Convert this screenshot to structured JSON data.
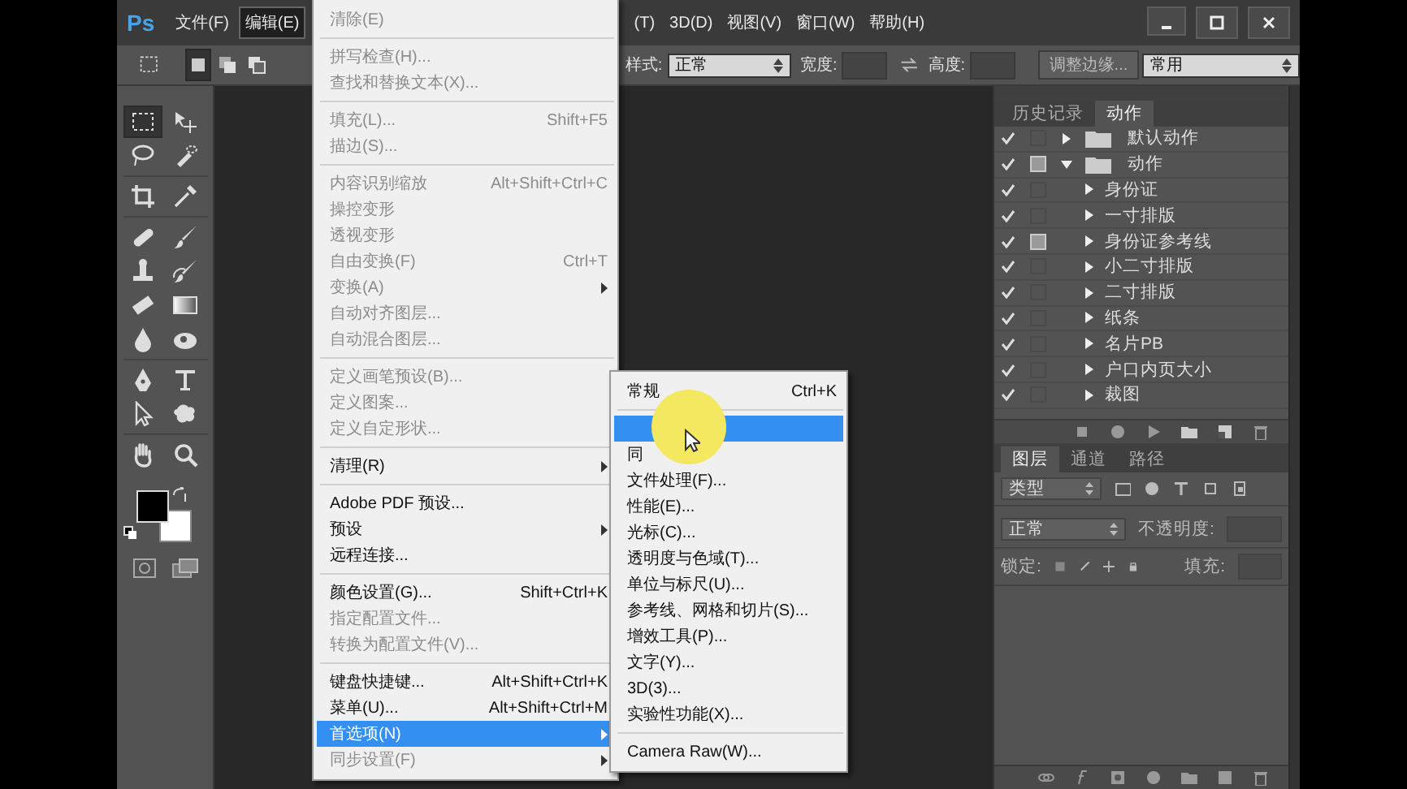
{
  "menu_bar": {
    "logo": "Ps",
    "items": [
      {
        "label": "文件(F)",
        "selected": false
      },
      {
        "label": "编辑(E)",
        "selected": true
      },
      {
        "label": "(T)",
        "selected": false
      },
      {
        "label": "3D(D)",
        "selected": false
      },
      {
        "label": "视图(V)",
        "selected": false
      },
      {
        "label": "窗口(W)",
        "selected": false
      },
      {
        "label": "帮助(H)",
        "selected": false
      }
    ]
  },
  "options_bar": {
    "style_label": "样式:",
    "style_value": "正常",
    "width_label": "宽度:",
    "height_label": "高度:",
    "refine_button": "调整边缘...",
    "workspace": "常用"
  },
  "tools": [
    {
      "kind": "marquee",
      "selected": true
    },
    {
      "kind": "move",
      "selected": false
    },
    {
      "kind": "lasso",
      "selected": false
    },
    {
      "kind": "quick-select",
      "selected": false
    },
    {
      "kind": "crop",
      "selected": false
    },
    {
      "kind": "eyedropper",
      "selected": false
    },
    {
      "kind": "healing",
      "selected": false
    },
    {
      "kind": "brush",
      "selected": false
    },
    {
      "kind": "stamp",
      "selected": false
    },
    {
      "kind": "history-brush",
      "selected": false
    },
    {
      "kind": "eraser",
      "selected": false
    },
    {
      "kind": "gradient",
      "selected": false
    },
    {
      "kind": "blur",
      "selected": false
    },
    {
      "kind": "dodge",
      "selected": false
    },
    {
      "kind": "pen",
      "selected": false
    },
    {
      "kind": "type",
      "selected": false
    },
    {
      "kind": "path-select",
      "selected": false
    },
    {
      "kind": "shape",
      "selected": false
    },
    {
      "kind": "hand",
      "selected": false
    },
    {
      "kind": "zoom",
      "selected": false
    }
  ],
  "edit_menu": {
    "groups": [
      [
        {
          "label": "清除(E)",
          "disabled": true,
          "submenu": false,
          "selected": false
        }
      ],
      [
        {
          "label": "拼写检查(H)...",
          "disabled": true,
          "submenu": false,
          "selected": false
        },
        {
          "label": "查找和替换文本(X)...",
          "disabled": true,
          "submenu": false,
          "selected": false
        }
      ],
      [
        {
          "label": "填充(L)...",
          "shortcut": "Shift+F5",
          "disabled": true,
          "submenu": false,
          "selected": false
        },
        {
          "label": "描边(S)...",
          "disabled": true,
          "submenu": false,
          "selected": false
        }
      ],
      [
        {
          "label": "内容识别缩放",
          "shortcut": "Alt+Shift+Ctrl+C",
          "disabled": true,
          "submenu": false,
          "selected": false
        },
        {
          "label": "操控变形",
          "disabled": true,
          "submenu": false,
          "selected": false
        },
        {
          "label": "透视变形",
          "disabled": true,
          "submenu": false,
          "selected": false
        },
        {
          "label": "自由变换(F)",
          "shortcut": "Ctrl+T",
          "disabled": true,
          "submenu": false,
          "selected": false
        },
        {
          "label": "变换(A)",
          "disabled": true,
          "submenu": true,
          "selected": false
        },
        {
          "label": "自动对齐图层...",
          "disabled": true,
          "submenu": false,
          "selected": false
        },
        {
          "label": "自动混合图层...",
          "disabled": true,
          "submenu": false,
          "selected": false
        }
      ],
      [
        {
          "label": "定义画笔预设(B)...",
          "disabled": true,
          "submenu": false,
          "selected": false
        },
        {
          "label": "定义图案...",
          "disabled": true,
          "submenu": false,
          "selected": false
        },
        {
          "label": "定义自定形状...",
          "disabled": true,
          "submenu": false,
          "selected": false
        }
      ],
      [
        {
          "label": "清理(R)",
          "disabled": false,
          "submenu": true,
          "selected": false
        }
      ],
      [
        {
          "label": "Adobe PDF 预设...",
          "disabled": false,
          "submenu": false,
          "selected": false
        },
        {
          "label": "预设",
          "disabled": false,
          "submenu": true,
          "selected": false
        },
        {
          "label": "远程连接...",
          "disabled": false,
          "submenu": false,
          "selected": false
        }
      ],
      [
        {
          "label": "颜色设置(G)...",
          "shortcut": "Shift+Ctrl+K",
          "disabled": false,
          "submenu": false,
          "selected": false
        },
        {
          "label": "指定配置文件...",
          "disabled": true,
          "submenu": false,
          "selected": false
        },
        {
          "label": "转换为配置文件(V)...",
          "disabled": true,
          "submenu": false,
          "selected": false
        }
      ],
      [
        {
          "label": "键盘快捷键...",
          "shortcut": "Alt+Shift+Ctrl+K",
          "disabled": false,
          "submenu": false,
          "selected": false
        },
        {
          "label": "菜单(U)...",
          "shortcut": "Alt+Shift+Ctrl+M",
          "disabled": false,
          "submenu": false,
          "selected": false
        },
        {
          "label": "首选项(N)",
          "disabled": false,
          "submenu": true,
          "selected": true
        },
        {
          "label": "同步设置(F)",
          "disabled": true,
          "submenu": true,
          "selected": false
        }
      ]
    ]
  },
  "preferences_submenu": {
    "groups": [
      [
        {
          "label": "常规",
          "shortcut": "Ctrl+K",
          "disabled": false,
          "submenu": false,
          "selected": false
        }
      ],
      [
        {
          "disabled": false,
          "submenu": false,
          "selected": true
        },
        {
          "label": "同",
          "disabled": false,
          "submenu": false,
          "selected": false
        },
        {
          "label": "文件处理(F)...",
          "disabled": false,
          "submenu": false,
          "selected": false
        },
        {
          "label": "性能(E)...",
          "disabled": false,
          "submenu": false,
          "selected": false
        },
        {
          "label": "光标(C)...",
          "disabled": false,
          "submenu": false,
          "selected": false
        },
        {
          "label": "透明度与色域(T)...",
          "disabled": false,
          "submenu": false,
          "selected": false
        },
        {
          "label": "单位与标尺(U)...",
          "disabled": false,
          "submenu": false,
          "selected": false
        },
        {
          "label": "参考线、网格和切片(S)...",
          "disabled": false,
          "submenu": false,
          "selected": false
        },
        {
          "label": "增效工具(P)...",
          "disabled": false,
          "submenu": false,
          "selected": false
        },
        {
          "label": "文字(Y)...",
          "disabled": false,
          "submenu": false,
          "selected": false
        },
        {
          "label": "3D(3)...",
          "disabled": false,
          "submenu": false,
          "selected": false
        },
        {
          "label": "实验性功能(X)...",
          "disabled": false,
          "submenu": false,
          "selected": false
        }
      ],
      [
        {
          "label": "Camera Raw(W)...",
          "disabled": false,
          "submenu": false,
          "selected": false
        }
      ]
    ]
  },
  "actions_panel": {
    "tabs": [
      {
        "label": "历史记录",
        "selected": false
      },
      {
        "label": "动作",
        "selected": true
      }
    ],
    "actions": [
      {
        "label": "默认动作",
        "checked": true,
        "dialog": false,
        "expanded": false
      },
      {
        "label": "动作",
        "checked": true,
        "dialog": true,
        "expanded": true,
        "children": [
          {
            "label": "身份证",
            "checked": true,
            "dialog": false,
            "expanded": false
          },
          {
            "label": "一寸排版",
            "checked": true,
            "dialog": false,
            "expanded": false
          },
          {
            "label": "身份证参考线",
            "checked": true,
            "dialog": true,
            "expanded": false
          },
          {
            "label": "小二寸排版",
            "checked": true,
            "dialog": false,
            "expanded": false
          },
          {
            "label": "二寸排版",
            "checked": true,
            "dialog": false,
            "expanded": false
          },
          {
            "label": "纸条",
            "checked": true,
            "dialog": false,
            "expanded": false
          },
          {
            "label": "名片PB",
            "checked": true,
            "dialog": false,
            "expanded": false
          },
          {
            "label": "户口内页大小",
            "checked": true,
            "dialog": false,
            "expanded": false
          },
          {
            "label": "裁图",
            "checked": true,
            "dialog": false,
            "expanded": false
          }
        ]
      }
    ]
  },
  "layers_panel": {
    "tabs": [
      {
        "label": "图层",
        "selected": true
      },
      {
        "label": "通道",
        "selected": false
      },
      {
        "label": "路径",
        "selected": false
      }
    ],
    "filter": "类型",
    "blend_mode": "正常",
    "opacity_label": "不透明度:",
    "lock_label": "锁定:",
    "fill_label": "填充:"
  }
}
